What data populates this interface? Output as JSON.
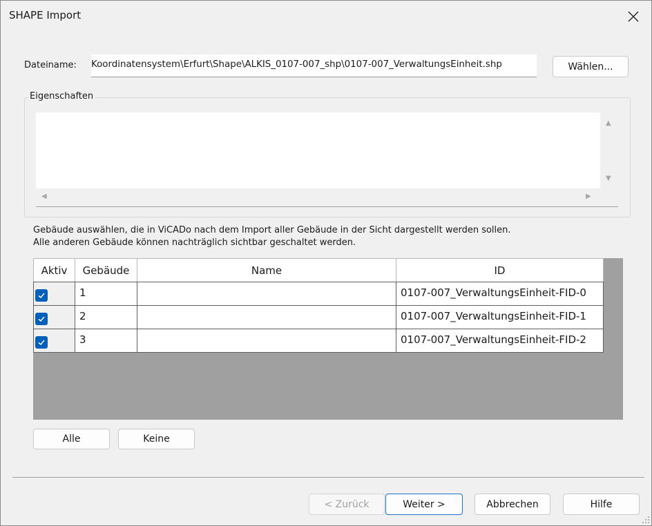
{
  "window": {
    "title": "SHAPE Import"
  },
  "file": {
    "label": "Dateiname:",
    "value": "Koordinatensystem\\Erfurt\\Shape\\ALKIS_0107-007_shp\\0107-007_VerwaltungsEinheit.shp",
    "browse_label": "Wählen..."
  },
  "properties": {
    "label": "Eigenschaften"
  },
  "info": {
    "line1": "Gebäude auswählen, die in ViCADo nach dem Import aller Gebäude in der Sicht dargestellt werden sollen.",
    "line2": "Alle anderen Gebäude können nachträglich sichtbar geschaltet werden."
  },
  "grid": {
    "columns": [
      "Aktiv",
      "Gebäude",
      "Name",
      "ID"
    ],
    "rows": [
      {
        "aktiv": true,
        "gebaeude": "1",
        "name": "",
        "id": "0107-007_VerwaltungsEinheit-FID-0"
      },
      {
        "aktiv": true,
        "gebaeude": "2",
        "name": "",
        "id": "0107-007_VerwaltungsEinheit-FID-1"
      },
      {
        "aktiv": true,
        "gebaeude": "3",
        "name": "",
        "id": "0107-007_VerwaltungsEinheit-FID-2"
      }
    ]
  },
  "selection_buttons": {
    "all": "Alle",
    "none": "Keine"
  },
  "footer": {
    "back": "< Zurück",
    "next": "Weiter >",
    "cancel": "Abbrechen",
    "help": "Hilfe"
  },
  "colors": {
    "accent": "#005fb8",
    "grid_background": "#a0a0a0"
  }
}
